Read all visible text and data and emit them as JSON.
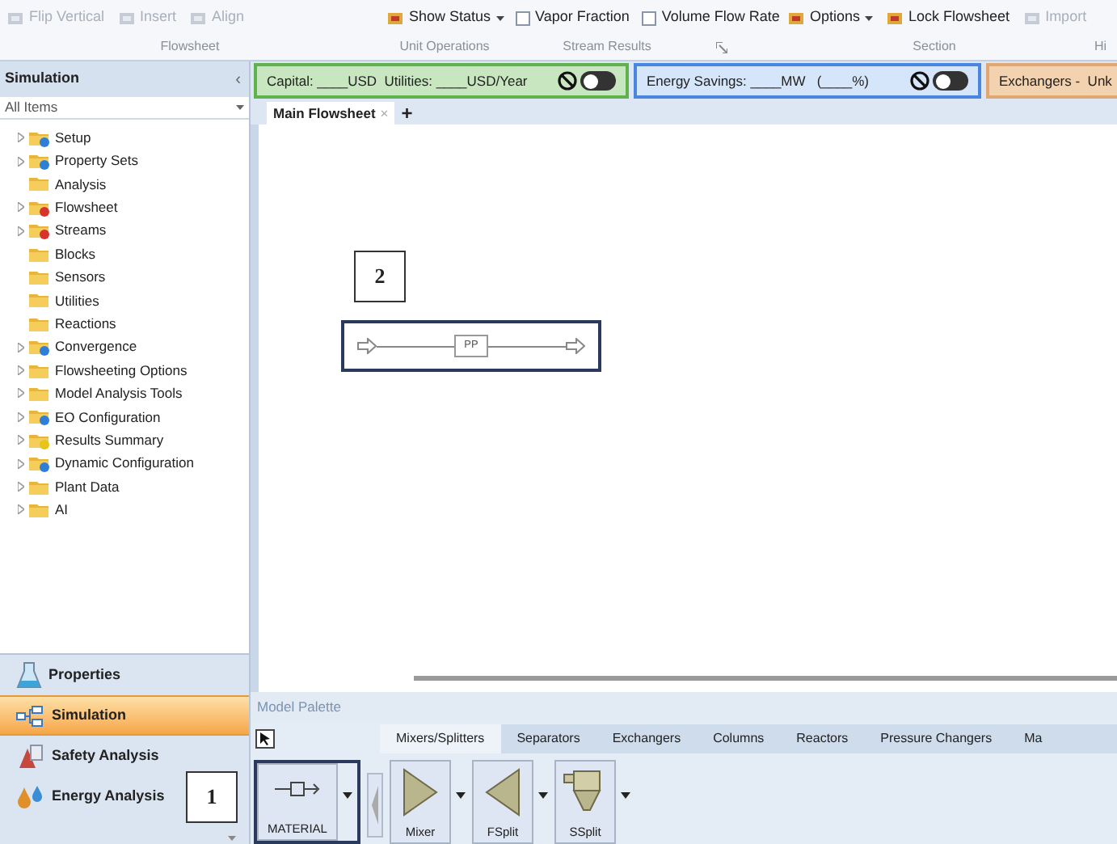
{
  "ribbon": {
    "groups": [
      {
        "label": "Flowsheet",
        "items": [
          {
            "kind": "button",
            "label": "Flip Vertical",
            "disabled": true
          },
          {
            "kind": "button",
            "label": "Insert",
            "disabled": true
          },
          {
            "kind": "button",
            "label": "Align",
            "disabled": true
          }
        ]
      },
      {
        "label": "Unit Operations",
        "items": [
          {
            "kind": "dropdown",
            "label": "Show Status",
            "disabled": false
          }
        ]
      },
      {
        "label": "Stream Results",
        "launcher": true,
        "items": [
          {
            "kind": "checkbox",
            "label": "Vapor Fraction",
            "checked": false
          },
          {
            "kind": "checkbox",
            "label": "Volume Flow Rate",
            "checked": false
          }
        ]
      },
      {
        "label": "Section",
        "items": [
          {
            "kind": "dropdown",
            "label": "Options",
            "disabled": false
          },
          {
            "kind": "button",
            "label": "Lock Flowsheet",
            "disabled": false
          },
          {
            "kind": "button",
            "label": "Import",
            "disabled": true
          }
        ]
      },
      {
        "label": "Hi"
      }
    ]
  },
  "sidebar": {
    "title": "Simulation",
    "collapse": "‹",
    "filter": "All Items",
    "tree": [
      {
        "label": "Setup",
        "expandable": true,
        "kind": "ok"
      },
      {
        "label": "Property Sets",
        "expandable": true,
        "kind": "ok"
      },
      {
        "label": "Analysis",
        "expandable": false,
        "kind": "plain"
      },
      {
        "label": "Flowsheet",
        "expandable": true,
        "kind": "error"
      },
      {
        "label": "Streams",
        "expandable": true,
        "kind": "error"
      },
      {
        "label": "Blocks",
        "expandable": false,
        "kind": "plain"
      },
      {
        "label": "Sensors",
        "expandable": false,
        "kind": "plain"
      },
      {
        "label": "Utilities",
        "expandable": false,
        "kind": "plain"
      },
      {
        "label": "Reactions",
        "expandable": false,
        "kind": "plain"
      },
      {
        "label": "Convergence",
        "expandable": true,
        "kind": "ok"
      },
      {
        "label": "Flowsheeting Options",
        "expandable": true,
        "kind": "plain"
      },
      {
        "label": "Model Analysis Tools",
        "expandable": true,
        "kind": "plain"
      },
      {
        "label": "EO Configuration",
        "expandable": true,
        "kind": "ok"
      },
      {
        "label": "Results Summary",
        "expandable": true,
        "kind": "results"
      },
      {
        "label": "Dynamic Configuration",
        "expandable": true,
        "kind": "ok"
      },
      {
        "label": "Plant Data",
        "expandable": true,
        "kind": "plain"
      },
      {
        "label": "AI",
        "expandable": true,
        "kind": "plain"
      }
    ],
    "nav": [
      {
        "label": "Properties",
        "selected": false
      },
      {
        "label": "Simulation",
        "selected": true
      },
      {
        "label": "Safety Analysis",
        "selected": false
      },
      {
        "label": "Energy Analysis",
        "selected": false
      }
    ]
  },
  "cost_bars": [
    {
      "kind": "cost",
      "text": "Capital: ____USD  Utilities: ____USD/Year",
      "on": false
    },
    {
      "kind": "energy",
      "text": "Energy Savings: ____MW   (____%)",
      "on": false
    },
    {
      "kind": "exchangers",
      "text": "Exchangers -  Unk"
    }
  ],
  "flowsheet_tabs": [
    {
      "label": "Main Flowsheet",
      "selected": true,
      "close": "×"
    }
  ],
  "add_tab": "+",
  "canvas": {
    "annotation": "2",
    "block": "PP"
  },
  "palette": {
    "title": "Model Palette",
    "tabs": [
      {
        "label": "Mixers/Splitters",
        "selected": true
      },
      {
        "label": "Separators",
        "selected": false
      },
      {
        "label": "Exchangers",
        "selected": false
      },
      {
        "label": "Columns",
        "selected": false
      },
      {
        "label": "Reactors",
        "selected": false
      },
      {
        "label": "Pressure Changers",
        "selected": false
      },
      {
        "label": "Ma",
        "selected": false
      }
    ],
    "stream": {
      "label": "MATERIAL",
      "highlighted": true,
      "annotation": "1"
    },
    "models": [
      {
        "label": "Mixer",
        "kind": "mixer"
      },
      {
        "label": "FSplit",
        "kind": "fsplit"
      },
      {
        "label": "SSplit",
        "kind": "ssplit"
      }
    ]
  }
}
